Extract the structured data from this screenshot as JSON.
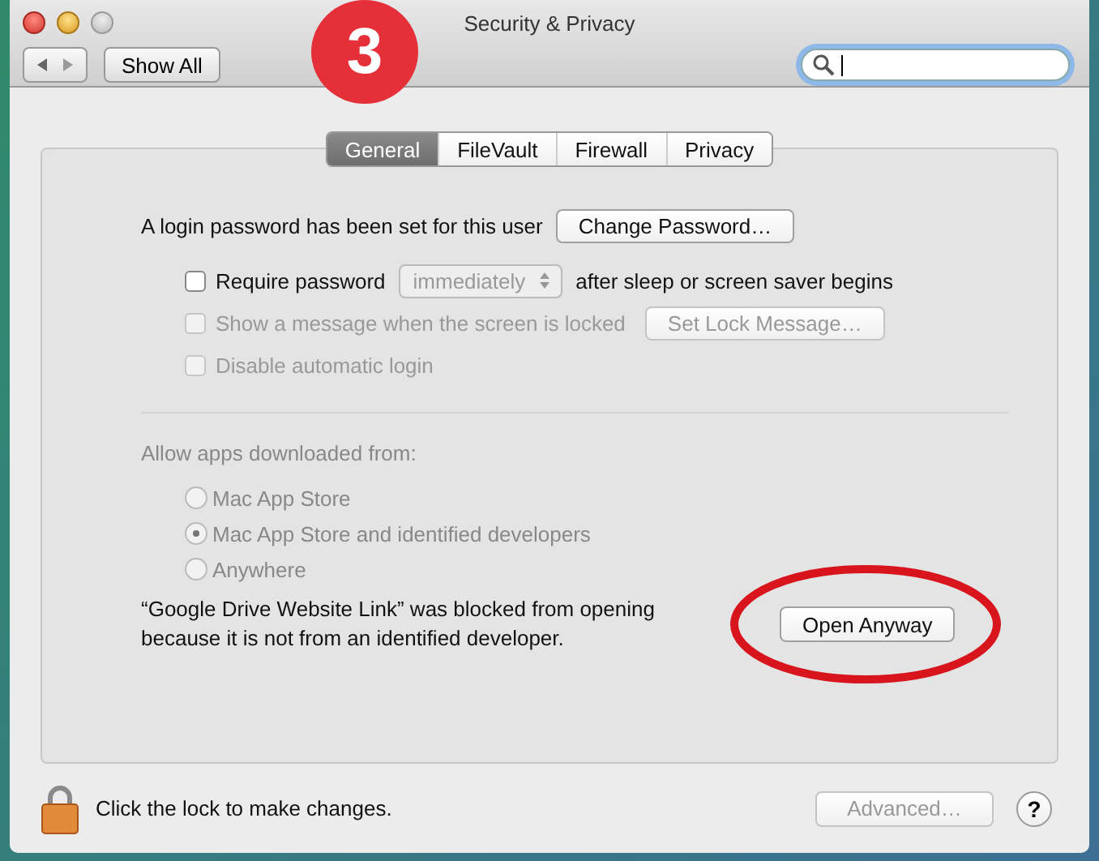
{
  "window": {
    "title": "Security & Privacy"
  },
  "toolbar": {
    "show_all": "Show All"
  },
  "annotation": {
    "step": "3"
  },
  "tabs": [
    {
      "label": "General",
      "selected": true
    },
    {
      "label": "FileVault",
      "selected": false
    },
    {
      "label": "Firewall",
      "selected": false
    },
    {
      "label": "Privacy",
      "selected": false
    }
  ],
  "general": {
    "password_text": "A login password has been set for this user",
    "change_password": "Change Password…",
    "options": [
      {
        "kind": "select",
        "label": "Require password",
        "checked": false,
        "disabled": false,
        "select": "immediately",
        "select_disabled": true,
        "suffix": "after sleep or screen saver begins"
      },
      {
        "kind": "button",
        "label": "Show a message when the screen is locked",
        "checked": false,
        "disabled": true,
        "button": "Set Lock Message…"
      },
      {
        "kind": "plain",
        "label": "Disable automatic login",
        "checked": false,
        "disabled": true
      }
    ]
  },
  "allow": {
    "heading": "Allow apps downloaded from:",
    "disabled": true,
    "options": [
      {
        "label": "Mac App Store",
        "selected": false
      },
      {
        "label": "Mac App Store and identified developers",
        "selected": true
      },
      {
        "label": "Anywhere",
        "selected": false
      }
    ]
  },
  "blocked": {
    "message": "“Google Drive Website Link” was blocked from opening because it is not from an identified developer.",
    "button": "Open Anyway",
    "highlighted": true
  },
  "footer": {
    "lock_text": "Click the lock to make changes.",
    "advanced": "Advanced…",
    "advanced_disabled": true,
    "help": "?"
  }
}
